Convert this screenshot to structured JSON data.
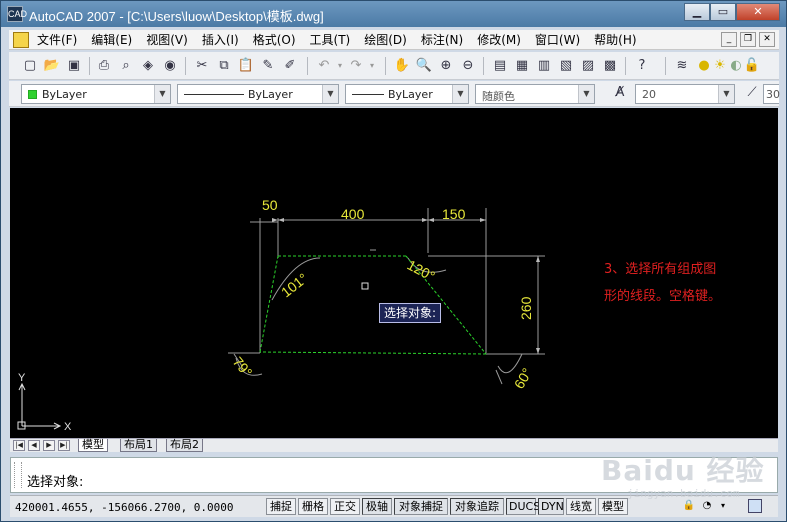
{
  "window": {
    "title": "AutoCAD 2007 - [C:\\Users\\luow\\Desktop\\模板.dwg]",
    "app_icon": "CAD"
  },
  "menus": [
    "文件(F)",
    "编辑(E)",
    "视图(V)",
    "插入(I)",
    "格式(O)",
    "工具(T)",
    "绘图(D)",
    "标注(N)",
    "修改(M)",
    "窗口(W)",
    "帮助(H)"
  ],
  "properties": {
    "layer": "ByLayer",
    "linetype": "ByLayer",
    "lineweight": "ByLayer",
    "plot_style": "随颜色",
    "text_height": "20",
    "scale_partial": "30"
  },
  "drawing": {
    "dimensions": [
      "50",
      "400",
      "150",
      "260"
    ],
    "angles": [
      "101°",
      "120°",
      "79°",
      "60°"
    ],
    "tooltip": "选择对象:",
    "ucs_x": "X",
    "ucs_y": "Y",
    "annotation": [
      "3、选择所有组成图",
      "形的线段。空格键。"
    ],
    "annotation_color": "#e02020",
    "dimension_color": "#e8e83a",
    "geometry_color": "#2bd32b"
  },
  "layout_tabs": [
    "模型",
    "布局1",
    "布局2"
  ],
  "command_prompt": "选择对象:",
  "status": {
    "coordinates": "420001.4655, -156066.2700, 0.0000",
    "toggles": [
      "捕捉",
      "栅格",
      "正交",
      "极轴",
      "对象捕捉",
      "对象追踪",
      "DUCS",
      "DYN",
      "线宽",
      "模型"
    ]
  },
  "watermark": {
    "brand": "Baidu 经验",
    "url": "jingyan.baidu.com"
  }
}
